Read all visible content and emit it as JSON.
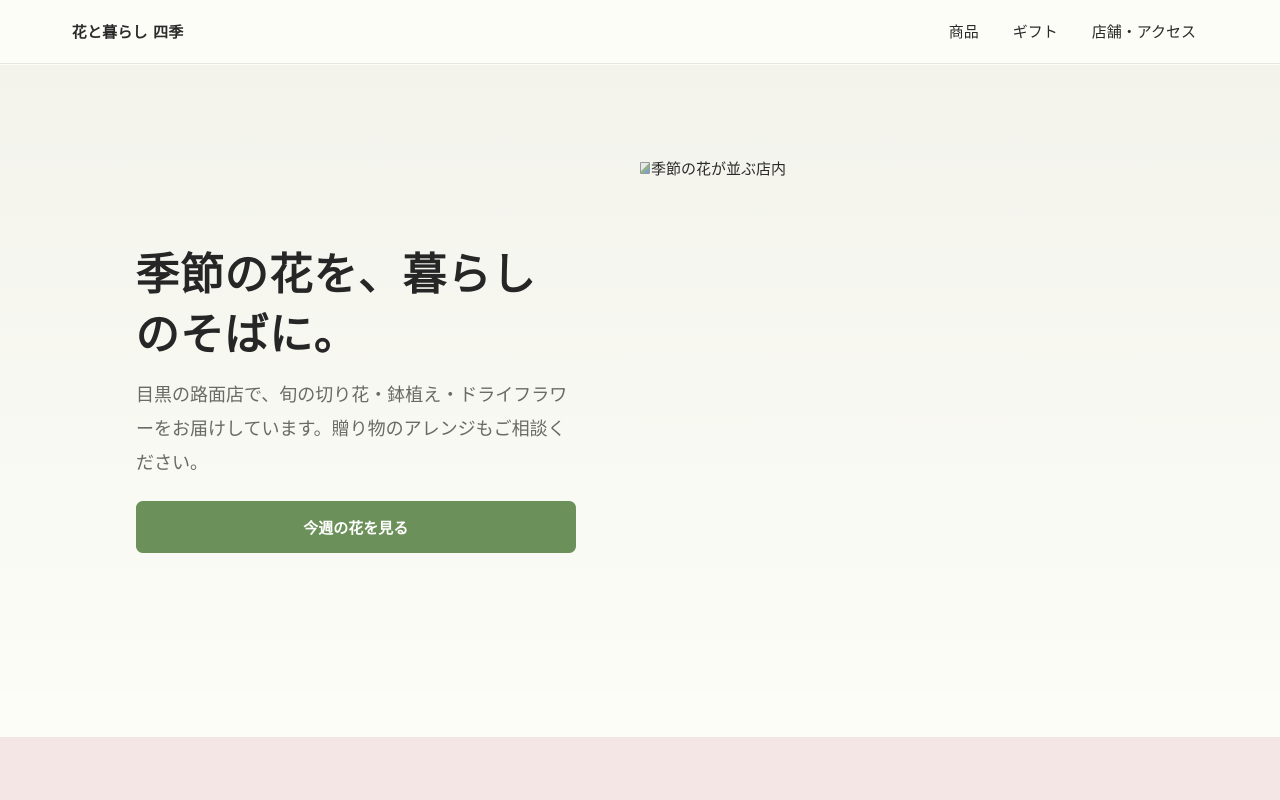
{
  "header": {
    "brand": "花と暮らし 四季",
    "nav": [
      {
        "label": "商品"
      },
      {
        "label": "ギフト"
      },
      {
        "label": "店舗・アクセス"
      }
    ]
  },
  "hero": {
    "title_line1": "季節の花を、暮らし",
    "title_line2": "のそばに。",
    "lead": "目黒の路面店で、旬の切り花・鉢植え・ドライフラワーをお届けしています。贈り物のアレンジもご相談ください。",
    "cta_label": "今週の花を見る",
    "image_alt": "季節の花が並ぶ店内"
  },
  "colors": {
    "accent": "#6b905a",
    "header_bg": "#fdfdf8",
    "next_section_bg": "#f3e6e4"
  },
  "icons": {
    "broken_image": "broken-image-icon"
  }
}
